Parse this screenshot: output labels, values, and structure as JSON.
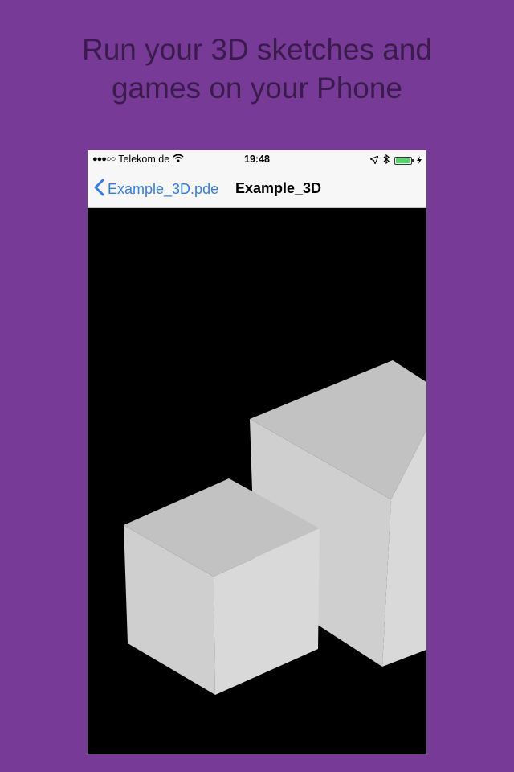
{
  "headline": {
    "line1": "Run your 3D sketches and",
    "line2": "games on your Phone"
  },
  "status_bar": {
    "signal_dots": "●●●○○",
    "carrier": "Telekom.de",
    "time": "19:48",
    "battery_fraction": 1.0
  },
  "nav_bar": {
    "back_label": "Example_3D.pde",
    "title": "Example_3D"
  },
  "colors": {
    "background": "#773b97",
    "headline_text": "#3a1b4c",
    "ios_blue": "#2f7cf6",
    "canvas": "#000000",
    "cube_top": "#c2c2c2",
    "cube_left": "#cfcfcf",
    "cube_right": "#d9d9d9"
  },
  "icons": [
    "wifi-icon",
    "location-arrow-icon",
    "bluetooth-icon",
    "battery-icon",
    "charging-bolt-icon",
    "back-chevron-icon"
  ]
}
